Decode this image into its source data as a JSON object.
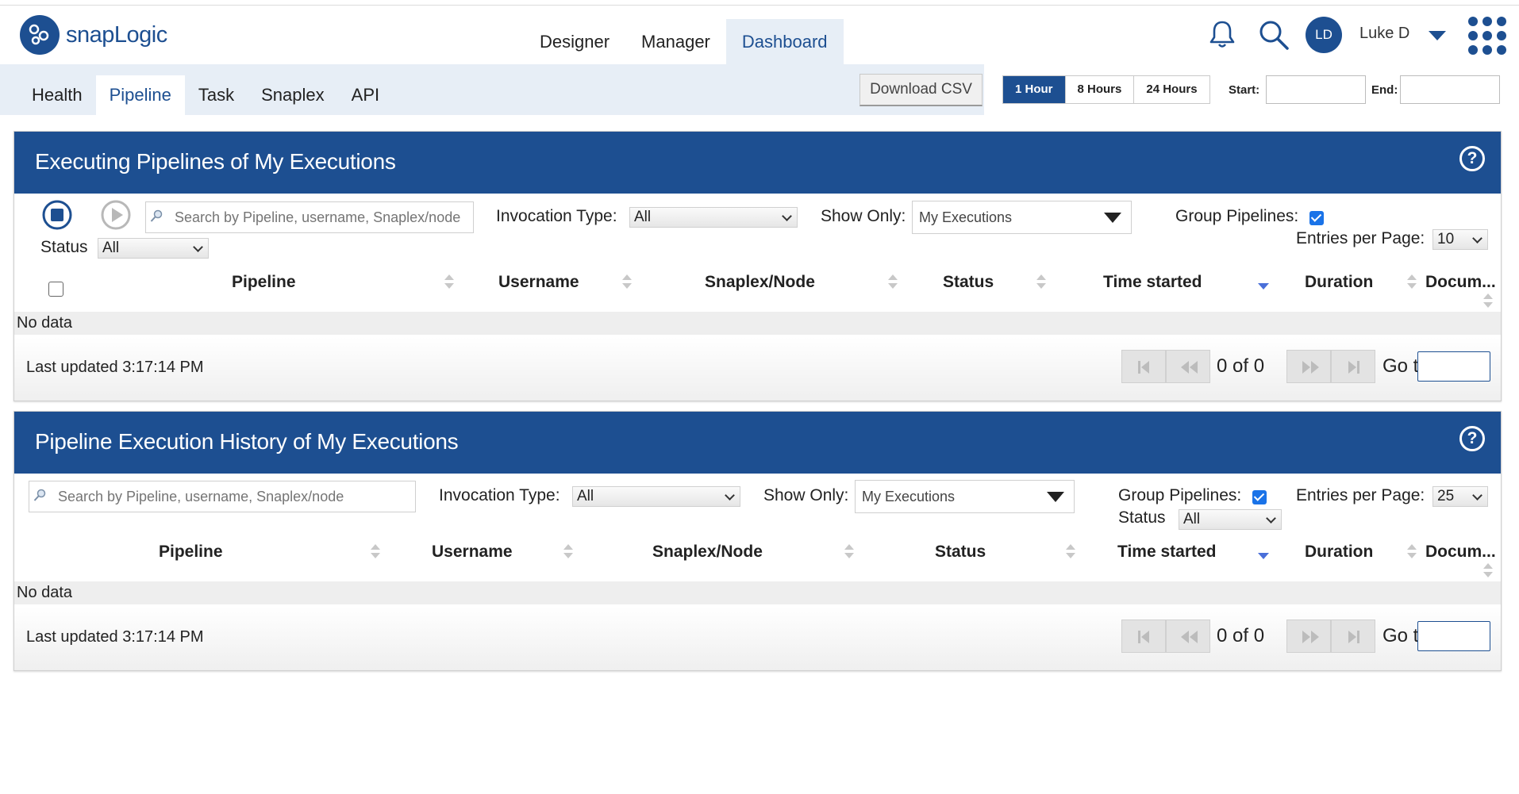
{
  "header": {
    "logo_text": "snapLogic",
    "nav": [
      "Designer",
      "Manager",
      "Dashboard"
    ],
    "active_nav": "Dashboard",
    "user_initials": "LD",
    "user_name": "Luke D"
  },
  "subnav": {
    "tabs": [
      "Health",
      "Pipeline",
      "Task",
      "Snaplex",
      "API"
    ],
    "active_tab": "Pipeline",
    "download_label": "Download CSV",
    "ranges": [
      "1 Hour",
      "8 Hours",
      "24 Hours"
    ],
    "active_range": "1 Hour",
    "start_label": "Start:",
    "end_label": "End:",
    "start_value": "",
    "end_value": ""
  },
  "panel1": {
    "title": "Executing Pipelines of My Executions",
    "search_placeholder": "Search by Pipeline, username, Snaplex/node",
    "invocation_label": "Invocation Type:",
    "invocation_value": "All",
    "show_only_label": "Show Only:",
    "show_only_value": "My Executions",
    "group_label": "Group Pipelines:",
    "group_checked": true,
    "entries_label": "Entries per Page:",
    "entries_value": "10",
    "status_label": "Status",
    "status_value": "All",
    "columns": [
      "Pipeline",
      "Username",
      "Snaplex/Node",
      "Status",
      "Time started",
      "Duration",
      "Docum..."
    ],
    "empty_text": "No data",
    "last_updated": "Last updated 3:17:14 PM",
    "pager_count": "0 of 0",
    "goto_label": "Go to"
  },
  "panel2": {
    "title": "Pipeline Execution History of My Executions",
    "search_placeholder": "Search by Pipeline, username, Snaplex/node",
    "invocation_label": "Invocation Type:",
    "invocation_value": "All",
    "show_only_label": "Show Only:",
    "show_only_value": "My Executions",
    "group_label": "Group Pipelines:",
    "group_checked": true,
    "entries_label": "Entries per Page:",
    "entries_value": "25",
    "status_label": "Status",
    "status_value": "All",
    "columns": [
      "Pipeline",
      "Username",
      "Snaplex/Node",
      "Status",
      "Time started",
      "Duration",
      "Docum..."
    ],
    "empty_text": "No data",
    "last_updated": "Last updated 3:17:14 PM",
    "pager_count": "0 of 0",
    "goto_label": "Go to"
  },
  "colors": {
    "brand": "#1d4f91",
    "subnav_bg": "#e7eef6",
    "checkbox": "#1a73e8"
  }
}
